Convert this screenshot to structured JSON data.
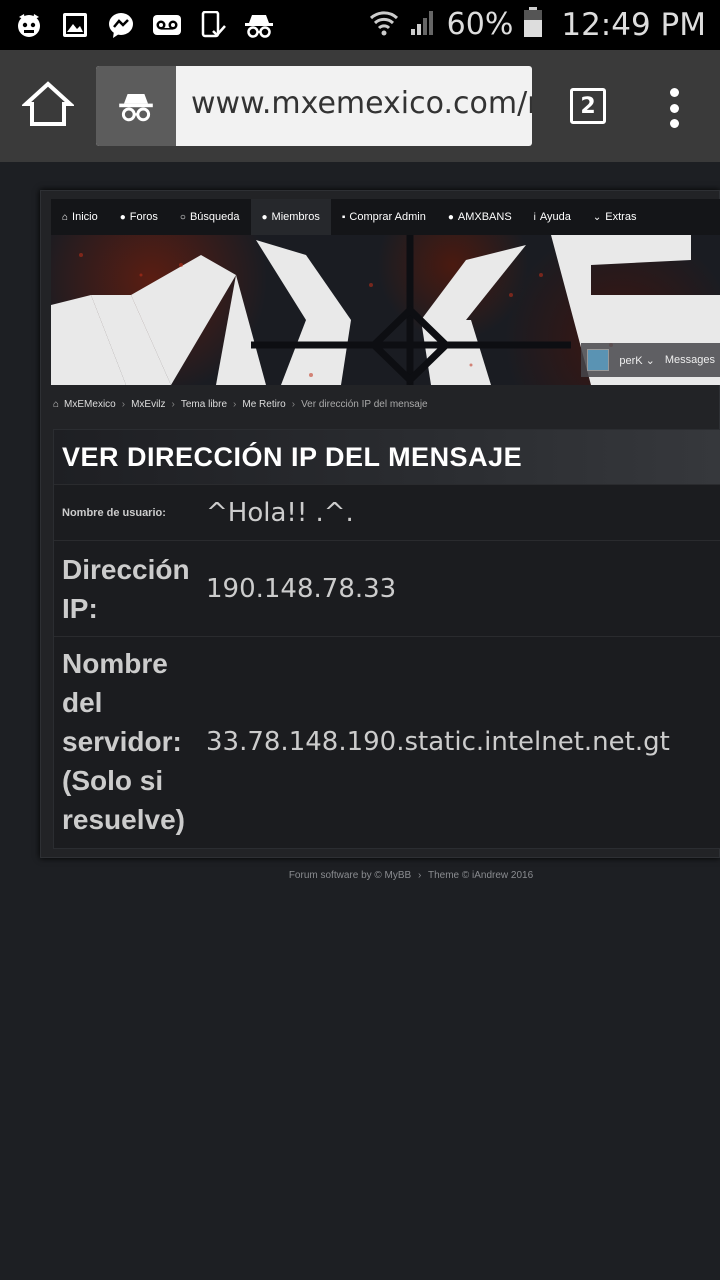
{
  "status_bar": {
    "battery_percent": "60%",
    "time": "12:49 PM",
    "left_icons": [
      "cat-icon",
      "image-icon",
      "messenger-icon",
      "voicemail-icon",
      "phone-check-icon",
      "incognito-icon"
    ]
  },
  "browser": {
    "url": "www.mxemexico.com/m",
    "tab_count": "2"
  },
  "nav": {
    "items": [
      {
        "icon": "home-icon",
        "label": "Inicio"
      },
      {
        "icon": "comments-icon",
        "label": "Foros"
      },
      {
        "icon": "search-icon",
        "label": "Búsqueda"
      },
      {
        "icon": "users-icon",
        "label": "Miembros"
      },
      {
        "icon": "lock-icon",
        "label": "Comprar Admin"
      },
      {
        "icon": "user-icon",
        "label": "AMXBANS"
      },
      {
        "icon": "info-icon",
        "label": "Ayuda"
      },
      {
        "icon": "chevron-down-icon",
        "label": "Extras"
      }
    ]
  },
  "user_menu": {
    "username": "perK",
    "messages_label": "Messages"
  },
  "breadcrumb": {
    "items": [
      "MxEMexico",
      "MxEvilz",
      "Tema libre",
      "Me Retiro"
    ],
    "current": "Ver dirección IP del mensaje"
  },
  "panel": {
    "title": "VER DIRECCIÓN IP DEL MENSAJE",
    "rows": [
      {
        "label": "Nombre de usuario:",
        "value": "^Hola!! .^."
      },
      {
        "label": "Dirección IP:",
        "value": "190.148.78.33"
      },
      {
        "label": "Nombre del servidor: (Solo si resuelve)",
        "value": "33.78.148.190.static.intelnet.net.gt"
      }
    ]
  },
  "footer": {
    "software": "Forum software by © MyBB",
    "theme": "Theme © iAndrew 2016"
  }
}
